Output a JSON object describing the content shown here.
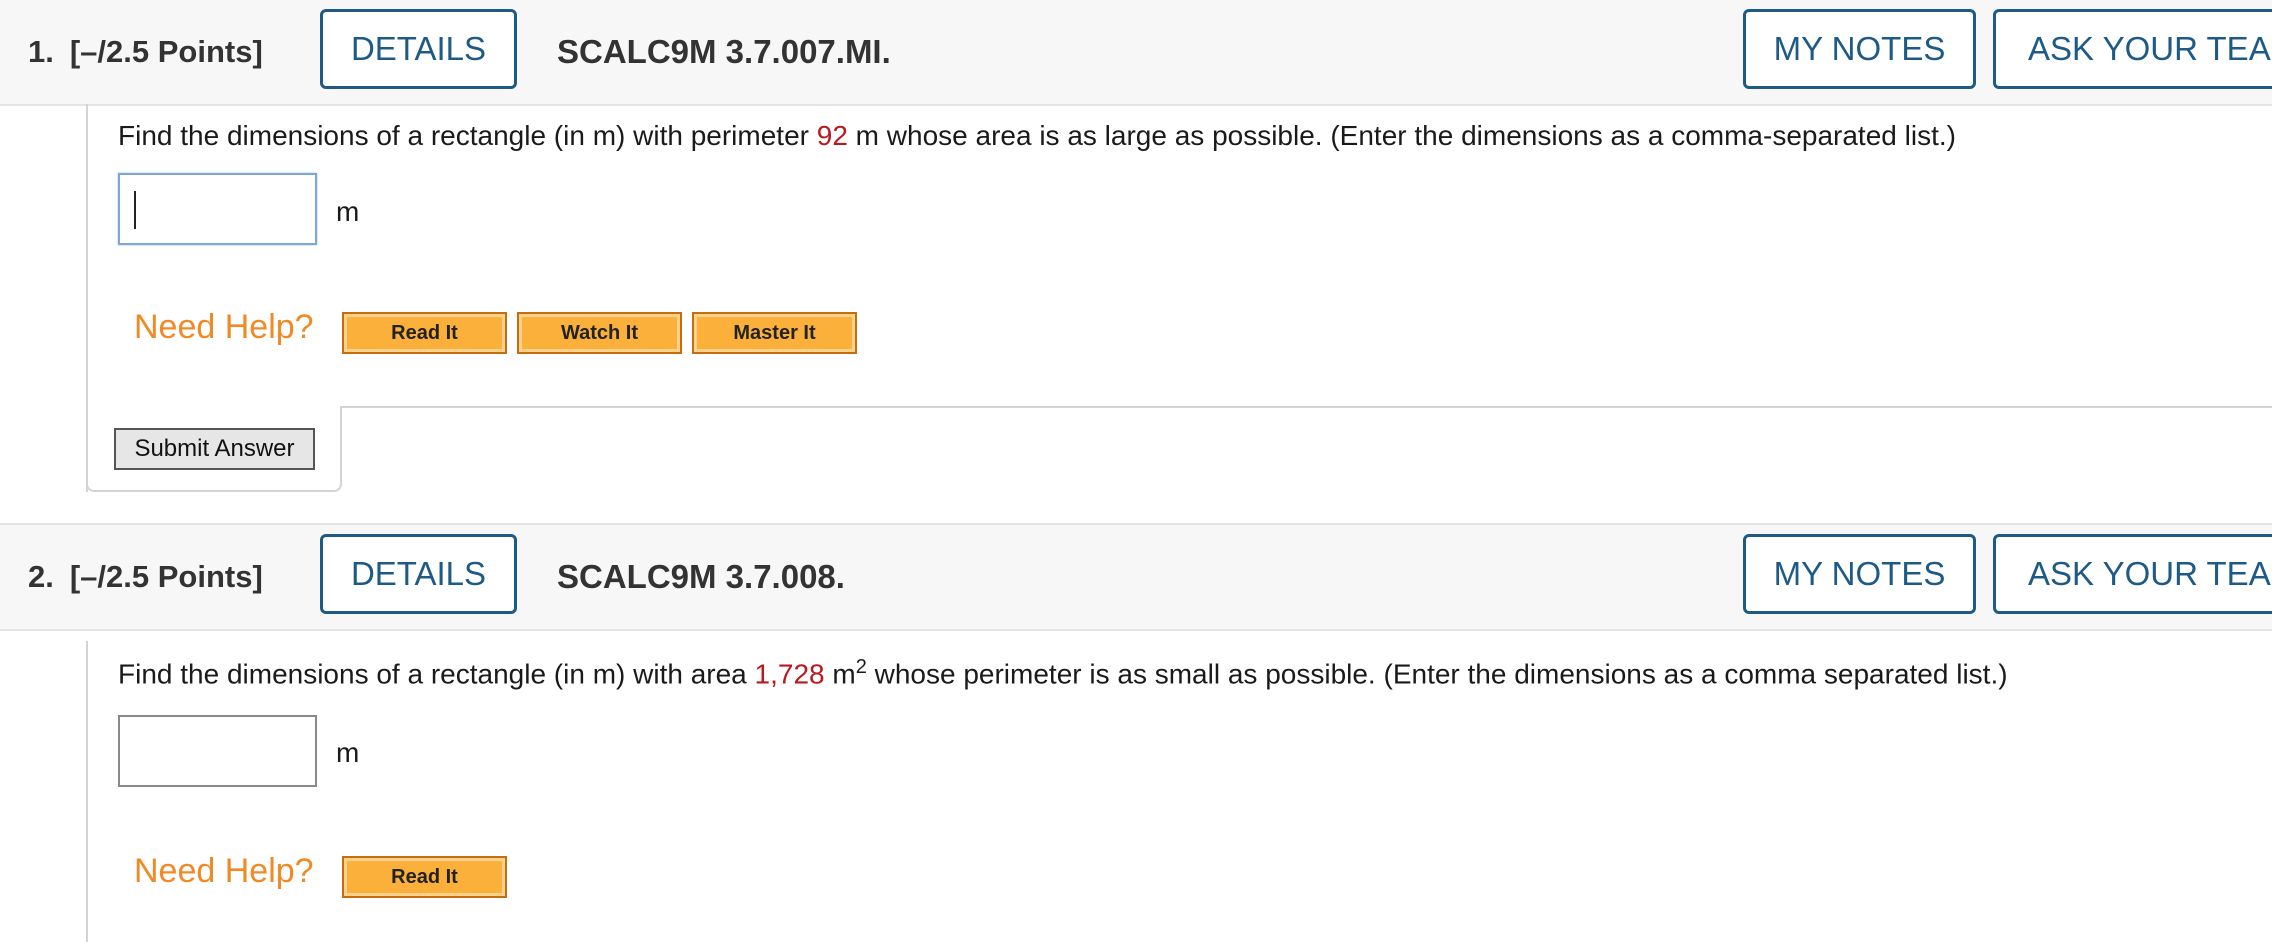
{
  "questions": [
    {
      "number": "1.",
      "points": "[–/2.5 Points]",
      "details_label": "DETAILS",
      "code": "SCALC9M 3.7.007.MI.",
      "my_notes_label": "MY NOTES",
      "ask_label": "ASK YOUR TEAC",
      "prompt_before": "Find the dimensions of a rectangle (in m) with perimeter ",
      "prompt_value": "92",
      "prompt_after": " m whose area is as large as possible. (Enter the dimensions as a comma-separated list.)",
      "answer_value": "",
      "unit": "m",
      "need_help": "Need Help?",
      "help_buttons": [
        "Read It",
        "Watch It",
        "Master It"
      ],
      "submit_label": "Submit Answer"
    },
    {
      "number": "2.",
      "points": "[–/2.5 Points]",
      "details_label": "DETAILS",
      "code": "SCALC9M 3.7.008.",
      "my_notes_label": "MY NOTES",
      "ask_label": "ASK YOUR TEAC",
      "prompt_before": "Find the dimensions of a rectangle (in m) with area ",
      "prompt_value": "1,728",
      "prompt_unit": " m",
      "prompt_sup": "2",
      "prompt_after": " whose perimeter is as small as possible. (Enter the dimensions as a comma separated list.)",
      "answer_value": "",
      "unit": "m",
      "need_help": "Need Help?",
      "help_buttons": [
        "Read It"
      ]
    }
  ],
  "colors": {
    "accent": "#1e5a86",
    "value_red": "#b8191e",
    "need_help_orange": "#f08a24",
    "help_button_fill": "#fbb03b"
  }
}
